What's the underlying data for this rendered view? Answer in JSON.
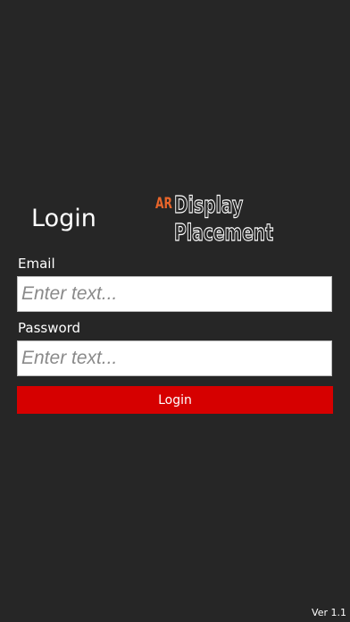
{
  "header": {
    "title": "Login"
  },
  "logo": {
    "ar": "AR",
    "line1": "Display",
    "line2": "Placement"
  },
  "form": {
    "email_label": "Email",
    "email_placeholder": "Enter text...",
    "password_label": "Password",
    "password_placeholder": "Enter text...",
    "login_label": "Login"
  },
  "footer": {
    "version": "Ver 1.1"
  },
  "colors": {
    "background": "#262626",
    "button": "#d60000",
    "logo_accent": "#e8652a"
  }
}
